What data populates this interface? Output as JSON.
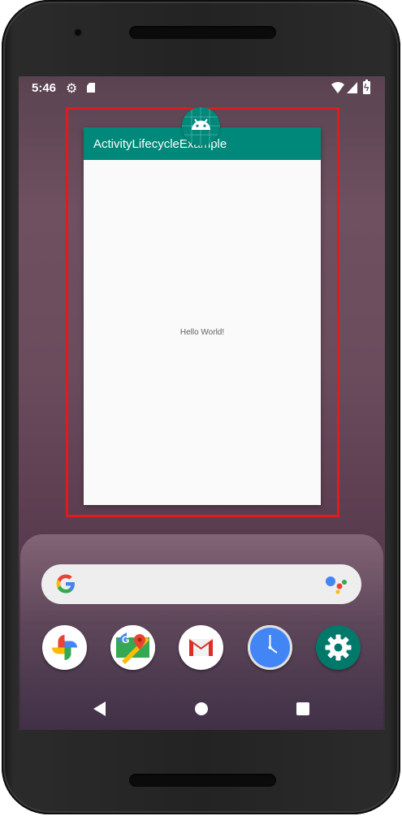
{
  "status_bar": {
    "time": "5:46",
    "icons": [
      "settings-icon",
      "sd-card-icon",
      "wifi-icon",
      "signal-icon",
      "battery-charging-icon"
    ]
  },
  "recents": {
    "app_title": "ActivityLifecycleExample",
    "content_text": "Hello World!",
    "app_icon": "android-icon",
    "toolbar_color": "#00897b",
    "highlight_color": "#e11b1b"
  },
  "search": {
    "left_icon": "google-g-icon",
    "right_icon": "google-assistant-icon"
  },
  "dock": {
    "apps": [
      "google-photos-icon",
      "google-maps-icon",
      "gmail-icon",
      "clock-icon",
      "settings-icon"
    ]
  },
  "nav": {
    "buttons": [
      "back-button",
      "home-button",
      "recents-button"
    ]
  }
}
